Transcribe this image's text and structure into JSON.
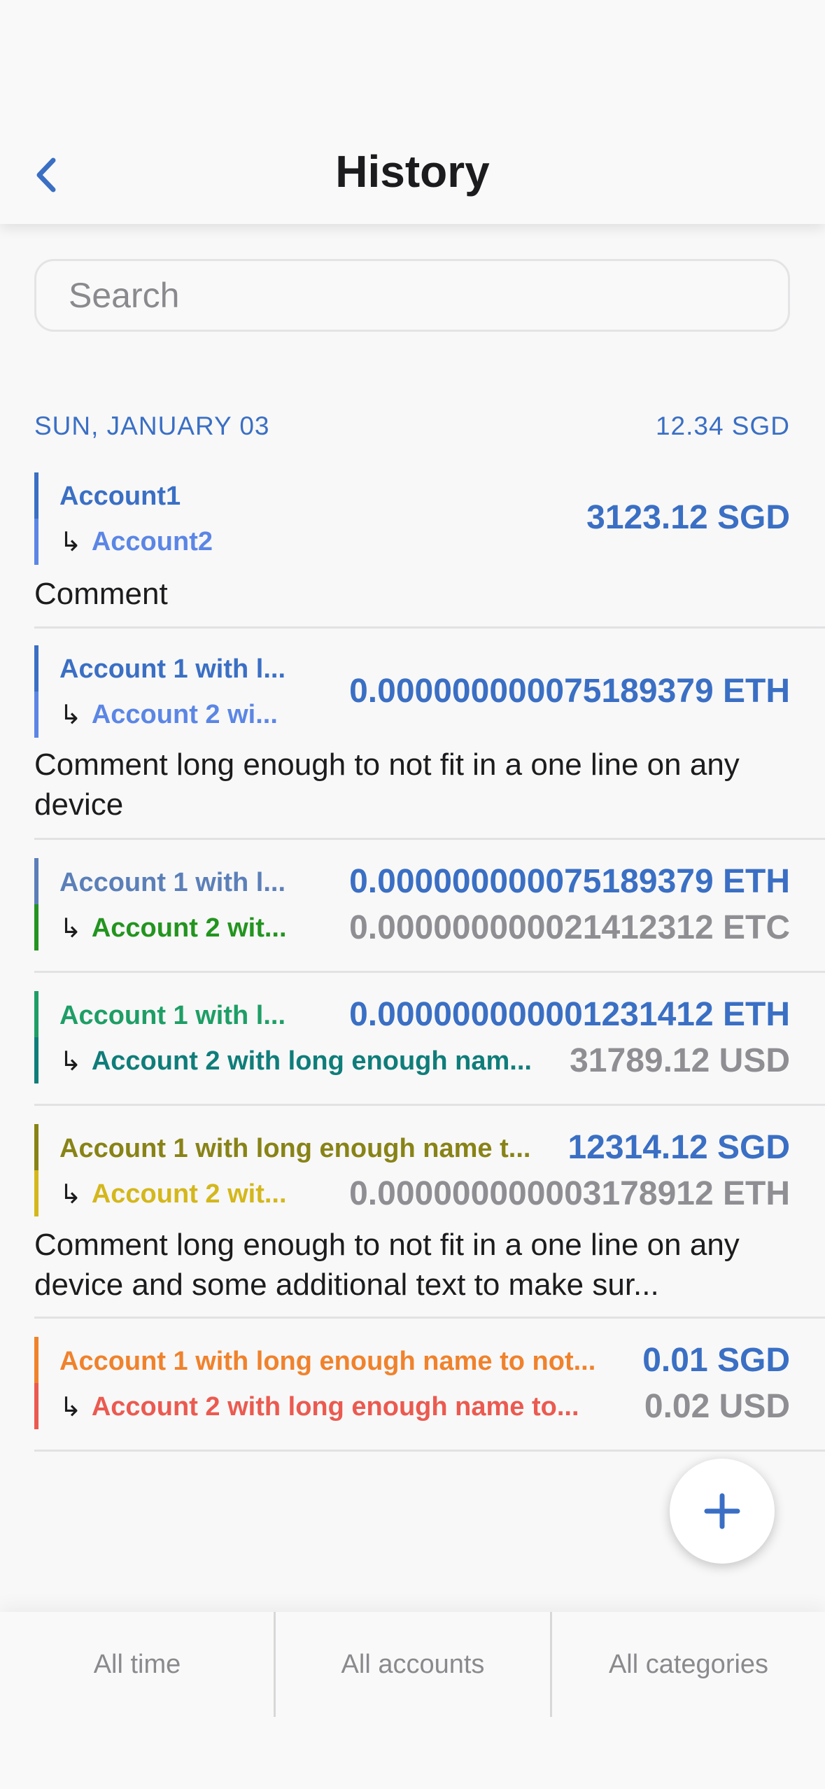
{
  "header": {
    "title": "History",
    "back_icon": "chevron-left-icon"
  },
  "search": {
    "placeholder": "Search",
    "value": ""
  },
  "section": {
    "date": "SUN, JANUARY 03",
    "total": "12.34 SGD"
  },
  "colors": {
    "accent": "#3a6fc4",
    "secondary_amount": "#8e8e93"
  },
  "transactions": [
    {
      "from": "Account1",
      "to": "Account2",
      "amount": "3123.12 SGD",
      "amount2": "",
      "comment": "Comment",
      "from_color": "#3a6fc4",
      "to_color": "#5b86e5"
    },
    {
      "from": "Account 1 with l...",
      "to": "Account 2 wi...",
      "amount": "0.000000000075189379 ETH",
      "amount2": "",
      "comment": "Comment long enough to not fit in a one line on any device",
      "from_color": "#3a6fc4",
      "to_color": "#5b86e5"
    },
    {
      "from": "Account 1 with l...",
      "to": "Account 2 wit...",
      "amount": "0.000000000075189379 ETH",
      "amount2": "0.000000000021412312 ETC",
      "comment": "",
      "from_color": "#5b7fb8",
      "to_color": "#23941f"
    },
    {
      "from": "Account 1 with l...",
      "to": "Account 2 with long enough nam...",
      "amount": "0.000000000001231412 ETH",
      "amount2": "31789.12 USD",
      "comment": "",
      "from_color": "#1e9e66",
      "to_color": "#0f7d7a"
    },
    {
      "from": "Account 1 with long enough name t...",
      "to": "Account 2 wit...",
      "amount": "12314.12 SGD",
      "amount2": "0.000000000003178912 ETH",
      "comment": "Comment long enough to not fit in a one line on any device and some additional text to make sur...",
      "from_color": "#888316",
      "to_color": "#d4b71c"
    },
    {
      "from": "Account 1 with long enough name to not...",
      "to": "Account 2 with long enough name to...",
      "amount": "0.01 SGD",
      "amount2": "0.02 USD",
      "comment": "",
      "from_color": "#f0822c",
      "to_color": "#eb5a50"
    }
  ],
  "fab": {
    "icon": "plus-icon"
  },
  "filters": {
    "time": "All time",
    "accounts": "All accounts",
    "categories": "All categories"
  }
}
